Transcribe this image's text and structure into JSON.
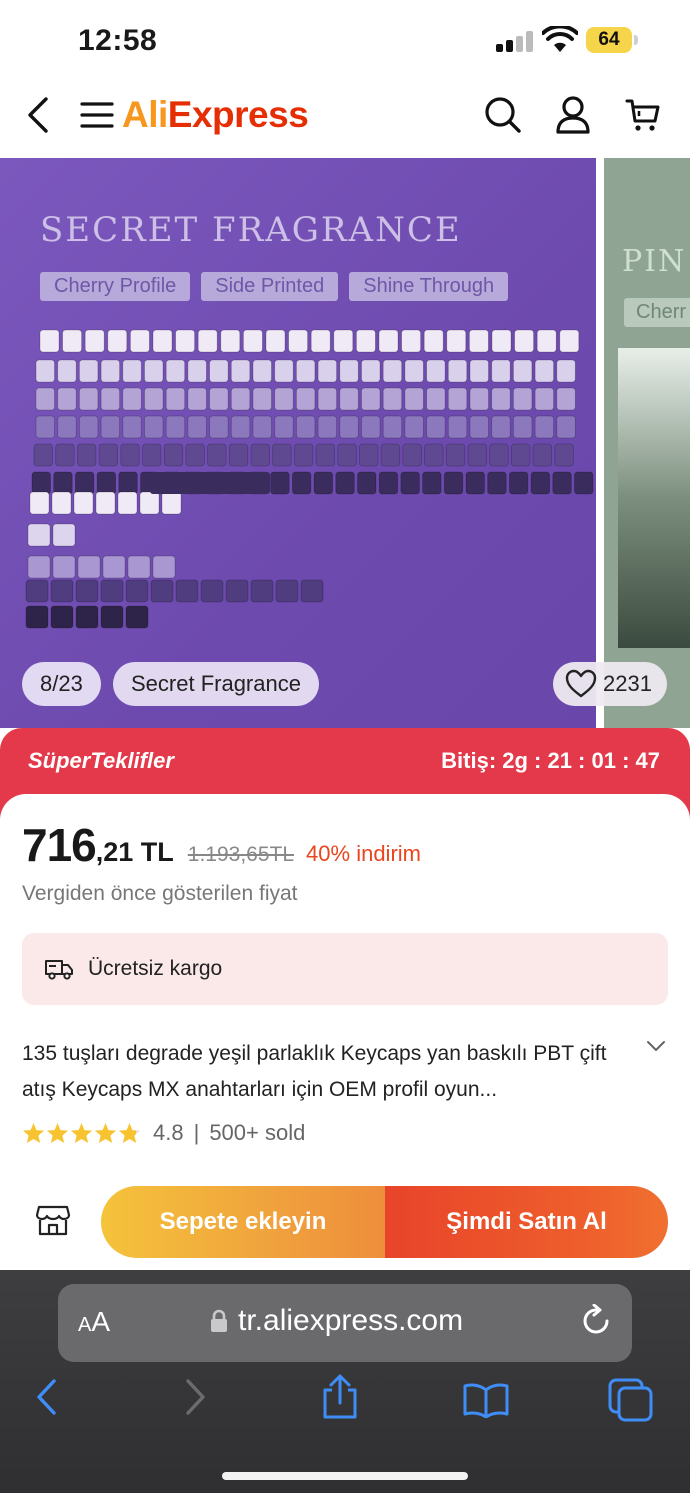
{
  "status_bar": {
    "time": "12:58",
    "battery": "64"
  },
  "header": {
    "logo_prefix": "Ali",
    "logo_suffix": "Express"
  },
  "gallery": {
    "slide_title": "SECRET FRAGRANCE",
    "tags": [
      "Cherry Profile",
      "Side Printed",
      "Shine Through"
    ],
    "next_slide_title": "PIN",
    "next_slide_tag": "Cherr",
    "counter": "8/23",
    "variant": "Secret Fragrance",
    "wishlist_count": "2231"
  },
  "super_deals": {
    "label": "SüperTeklifler",
    "ends": "Bitiş: 2g : 21 : 01 : 47"
  },
  "price": {
    "integer": "716",
    "decimal": ",21 TL",
    "original": "1.193,65TL",
    "discount": "40% indirim",
    "vat_note": "Vergiden önce gösterilen fiyat"
  },
  "shipping": {
    "label": "Ücretsiz kargo"
  },
  "product": {
    "title": "135 tuşları degrade yeşil parlaklık Keycaps yan baskılı PBT çift atış Keycaps MX anahtarları için OEM profil oyun...",
    "rating": "4.8",
    "separator": "|",
    "sold": "500+ sold",
    "stars": 4.8
  },
  "actions": {
    "add_to_cart": "Sepete ekleyin",
    "buy_now": "Şimdi Satın Al"
  },
  "browser": {
    "aa_small": "A",
    "aa_large": "A",
    "url": "tr.aliexpress.com"
  },
  "colors": {
    "brand": "#e62e04",
    "deal_red": "#e4394a",
    "discount": "#e9451f"
  }
}
